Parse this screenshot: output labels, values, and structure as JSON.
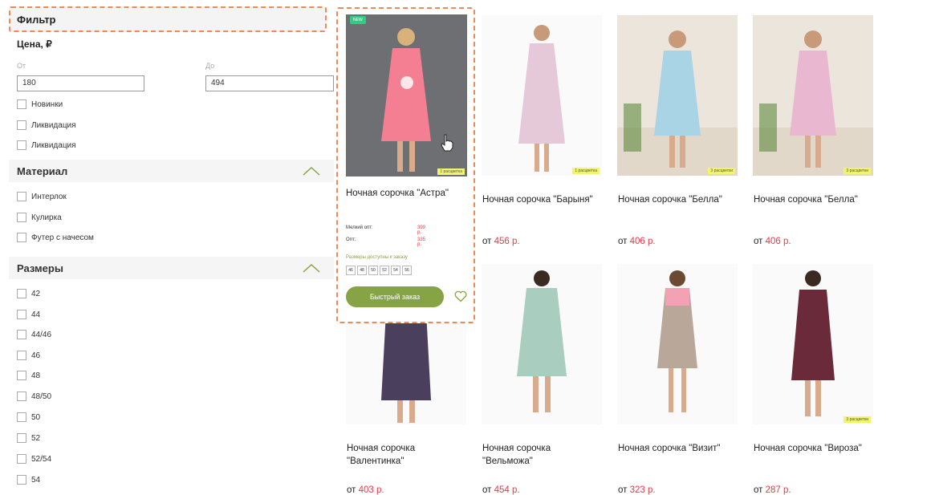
{
  "filter": {
    "title": "Фильтр",
    "price_label": "Цена, ₽",
    "from_label": "От",
    "to_label": "До",
    "from_value": "180",
    "to_value": "494",
    "flags": [
      "Новинки",
      "Ликвидация",
      "Ликвидация"
    ],
    "material_title": "Материал",
    "materials": [
      "Интерлок",
      "Кулирка",
      "Футер с начесом"
    ],
    "sizes_title": "Размеры",
    "sizes": [
      "42",
      "44",
      "44/46",
      "46",
      "48",
      "48/50",
      "50",
      "52",
      "52/54",
      "54"
    ]
  },
  "active_product": {
    "badge": "NEW",
    "tag": "1 расцветка",
    "title": "Ночная сорочка \"Астра\"",
    "small_opt_label": "Мелкий опт:",
    "small_opt_price": "399 р.",
    "opt_label": "Опт:",
    "opt_price": "335 р.",
    "sizes_label": "Размеры доступны к заказу",
    "sizes": [
      "46",
      "48",
      "50",
      "52",
      "54",
      "56"
    ],
    "button": "Быстрый заказ"
  },
  "products": [
    {
      "title": "Ночная сорочка \"Барыня\"",
      "price_prefix": "от",
      "price": "456 р.",
      "tag": "1 расцветка",
      "dress_color": "#e6c9d8"
    },
    {
      "title": "Ночная сорочка \"Белла\"",
      "price_prefix": "от",
      "price": "406 р.",
      "tag": "3 расцветки",
      "dress_color": "#a9d4e6"
    },
    {
      "title": "Ночная сорочка \"Белла\"",
      "price_prefix": "от",
      "price": "406 р.",
      "tag": "3 расцветки",
      "dress_color": "#e9b8d0"
    },
    {
      "title": "Ночная сорочка \"Валентинка\"",
      "price_prefix": "от",
      "price": "403 р.",
      "tag": "",
      "dress_color": "#4a3f5c"
    },
    {
      "title": "Ночная сорочка \"Вельможа\"",
      "price_prefix": "от",
      "price": "454 р.",
      "tag": "",
      "dress_color": "#a9cdbf"
    },
    {
      "title": "Ночная сорочка \"Визит\"",
      "price_prefix": "от",
      "price": "323 р.",
      "tag": "",
      "dress_color": "#b9a79a"
    },
    {
      "title": "Ночная сорочка \"Вироза\"",
      "price_prefix": "от",
      "price": "287 р.",
      "tag": "3 расцветки",
      "dress_color": "#6a2a3a"
    }
  ],
  "colors": {
    "accent": "#f08a54",
    "price": "#e8394a",
    "button": "#86a444",
    "new_badge": "#35c986"
  }
}
